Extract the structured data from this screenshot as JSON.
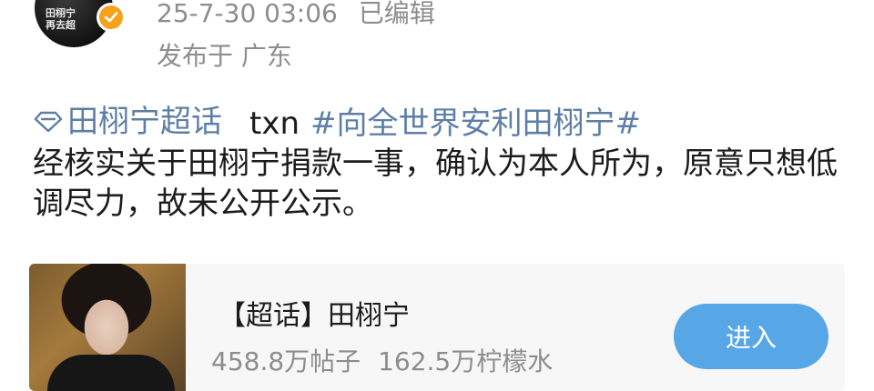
{
  "header": {
    "avatar_text": "田栩宁\n再去超",
    "timestamp": "25-7-30 03:06",
    "edited_label": "已编辑",
    "location": "发布于 广东",
    "badge_color": "#f7a21b"
  },
  "post": {
    "super_topic_label": "田栩宁超话",
    "prefix_text": "txn",
    "hashtag": "#向全世界安利田栩宁#",
    "body": "经核实关于田栩宁捐款一事，确认为本人所为，原意只想低调尽力，故未公开公示。",
    "link_color": "#5d7fa5"
  },
  "card": {
    "title": "【超话】田栩宁",
    "posts_count": "458.8万帖子",
    "followers_count": "162.5万柠檬水",
    "enter_label": "进入",
    "button_color": "#57a6e6"
  }
}
